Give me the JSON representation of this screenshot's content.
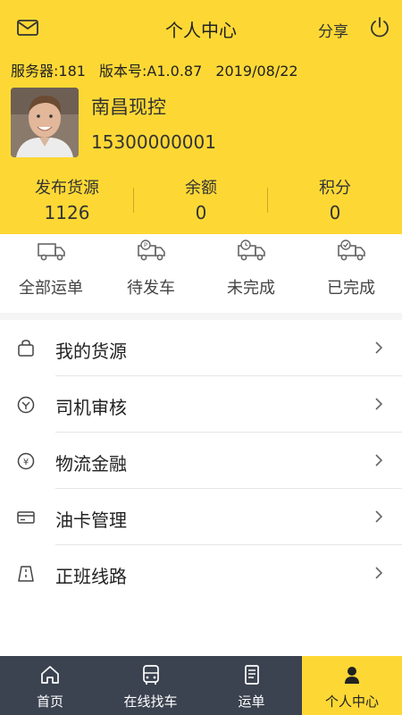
{
  "header": {
    "title": "个人中心",
    "share_label": "分享",
    "server": "服务器:181",
    "version": "版本号:A1.0.87",
    "date": "2019/08/22",
    "user_name": "南昌现控",
    "phone": "15300000001",
    "bg_color": "#fdd835"
  },
  "stats": [
    {
      "label": "发布货源",
      "value": "1126"
    },
    {
      "label": "余额",
      "value": "0"
    },
    {
      "label": "积分",
      "value": "0"
    }
  ],
  "orders": [
    {
      "label": "全部运单",
      "icon": "truck-all-icon"
    },
    {
      "label": "待发车",
      "icon": "truck-pending-icon"
    },
    {
      "label": "未完成",
      "icon": "truck-clock-icon"
    },
    {
      "label": "已完成",
      "icon": "truck-done-icon"
    }
  ],
  "menu": [
    {
      "label": "我的货源",
      "icon": "bag-icon"
    },
    {
      "label": "司机审核",
      "icon": "review-icon"
    },
    {
      "label": "物流金融",
      "icon": "yuan-icon"
    },
    {
      "label": "油卡管理",
      "icon": "card-icon"
    },
    {
      "label": "正班线路",
      "icon": "route-icon"
    }
  ],
  "tabs": [
    {
      "label": "首页",
      "icon": "home-icon"
    },
    {
      "label": "在线找车",
      "icon": "bus-icon"
    },
    {
      "label": "运单",
      "icon": "document-icon"
    },
    {
      "label": "个人中心",
      "icon": "person-icon",
      "active": true
    }
  ]
}
